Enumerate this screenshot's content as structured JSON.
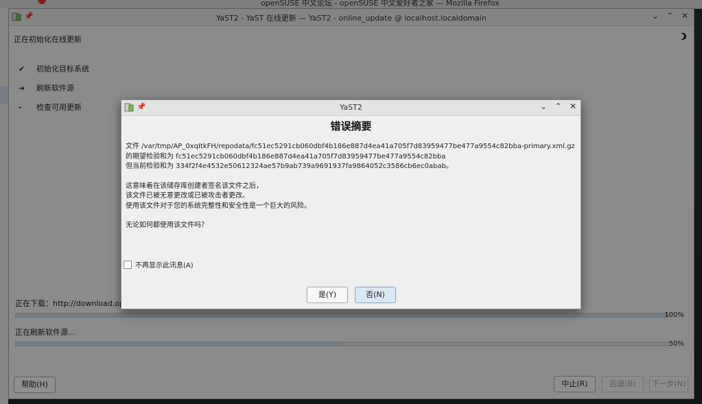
{
  "background": {
    "firefox_title": "openSUSE 中文论坛 - openSUSE 中文爱好者之家 — Mozilla Firefox"
  },
  "main_window": {
    "title": "YaST2 - YaST 在线更新 — YaST2 - online_update @ localhost.localdomain",
    "heading": "正在初始化在线更新",
    "steps": [
      {
        "mark": "✔",
        "label": "初始化目标系统"
      },
      {
        "mark": "➔",
        "label": "刷新软件源"
      },
      {
        "mark": "-",
        "label": "检查可用更新"
      }
    ],
    "download_label": "正在下载：http://download.opensu",
    "download_progress_pct": "100%",
    "download_progress_value": 100,
    "refresh_label": "正在刷新软件源...",
    "refresh_progress_pct": "50%",
    "refresh_progress_value": 50,
    "buttons": {
      "help": "帮助(H)",
      "abort": "中止(R)",
      "back": "后退(B)",
      "next": "下一步(N)"
    }
  },
  "dialog": {
    "title": "YaST2",
    "heading": "错误摘要",
    "line1": "文件 /var/tmp/AP_0xqItkFH/repodata/fc51ec5291cb060dbf4b186e887d4ea41a705f7d83959477be477a9554c82bba-primary.xml.gz 的期望检验和为 fc51ec5291cb060dbf4b186e887d4ea41a705f7d83959477be477a9554c82bba",
    "line2": "但当前检验和为 334f2f4e4532e50612324ae57b9ab739a9691937fa9864052c3586cb6ec0abab。",
    "line3": "这意味着在该储存库创建者签名该文件之后，",
    "line4": "该文件已被无意更改或已被攻击者更改。",
    "line5": "使用该文件对于您的系统完整性和安全性是一个巨大的风险。",
    "question": "无论如何都使用该文件吗？",
    "checkbox_label": "不再显示此讯息(A)",
    "yes_label": "是(Y)",
    "no_label": "否(N)"
  },
  "colors": {
    "dialog_default_button": "#dbe7f2",
    "progress_fill": "#c8d7e6"
  }
}
